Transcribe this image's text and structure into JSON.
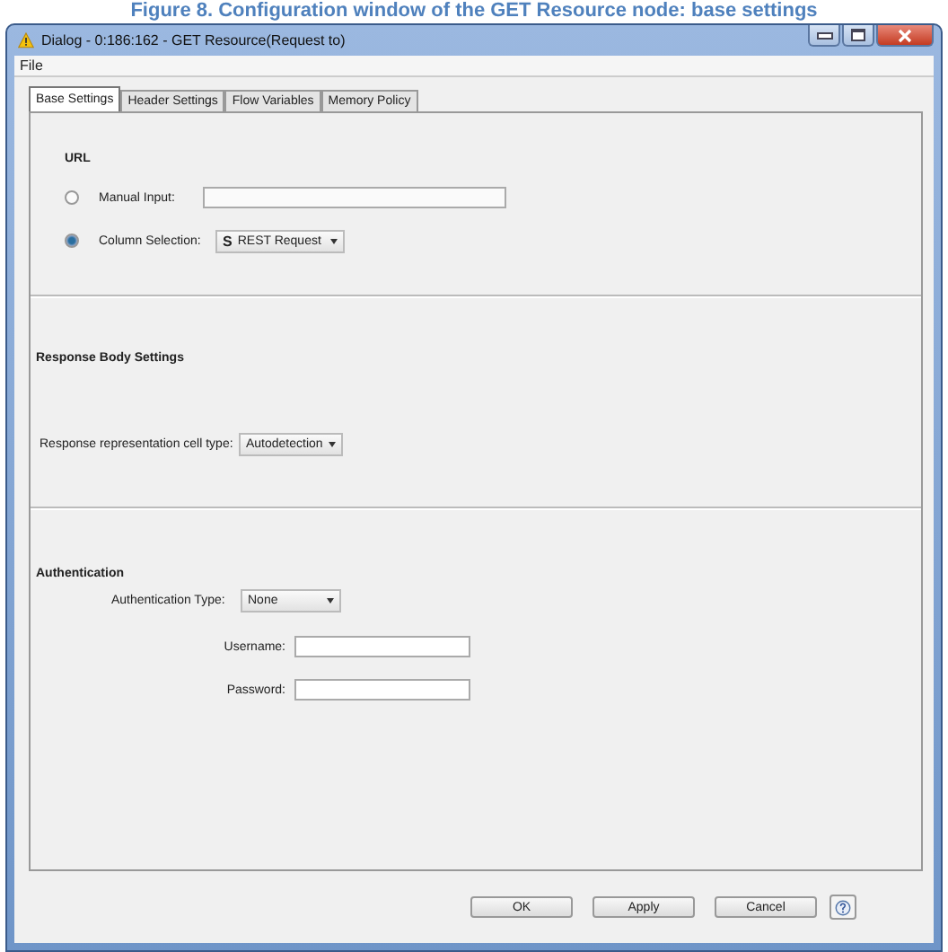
{
  "caption": "Figure 8. Configuration window of the GET Resource node: base settings",
  "window": {
    "title": "Dialog - 0:186:162 - GET Resource(Request to)"
  },
  "menu": [
    "File"
  ],
  "tabs": [
    {
      "label": "Base Settings",
      "selected": true
    },
    {
      "label": "Header Settings",
      "selected": false
    },
    {
      "label": "Flow Variables",
      "selected": false
    },
    {
      "label": "Memory Policy",
      "selected": false
    }
  ],
  "url": {
    "heading": "URL",
    "options": [
      {
        "label": "Manual Input:",
        "selected": false,
        "kind": "field"
      },
      {
        "label": "Column Selection:",
        "selected": true,
        "kind": "dropdown",
        "value": "REST Request",
        "badge": "S"
      }
    ]
  },
  "response": {
    "heading": "Response Body Settings",
    "label": "Response representation cell type:",
    "value": "Autodetection"
  },
  "auth": {
    "heading": "Authentication",
    "type_label": "Authentication Type:",
    "type_value": "None",
    "fields": [
      {
        "label": "Username:"
      },
      {
        "label": "Password:"
      }
    ]
  },
  "buttons": [
    "OK",
    "Apply",
    "Cancel"
  ]
}
